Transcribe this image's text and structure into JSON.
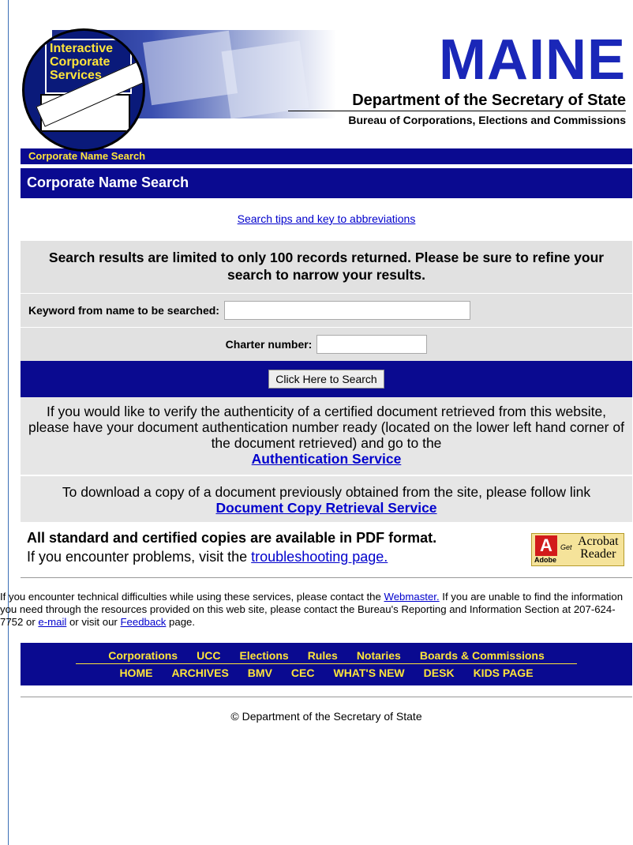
{
  "header": {
    "logo_lines": [
      "Interactive",
      "Corporate",
      "Services"
    ],
    "state": "MAINE",
    "department": "Department of the Secretary of State",
    "bureau": "Bureau of Corporations, Elections and Commissions"
  },
  "breadcrumb": "Corporate Name Search",
  "page_title": "Corporate Name Search",
  "tips_link": "Search tips and key to abbreviations",
  "notice": "Search results are limited to only 100 records returned. Please be sure to refine your search to narrow your results.",
  "form": {
    "keyword_label": "Keyword from name to be searched:",
    "keyword_value": "",
    "charter_label": "Charter number:",
    "charter_value": "",
    "search_button": "Click Here to Search"
  },
  "verify": {
    "text": "If you would like to verify the authenticity of a certified document retrieved from this website, please have your document authentication number ready (located on the lower left hand corner of the document retrieved) and go to the",
    "link": "Authentication Service"
  },
  "download": {
    "text": "To download a copy of a document previously obtained from the site, please follow link",
    "link": "Document Copy Retrieval Service"
  },
  "pdf": {
    "line1": "All standard and certified copies are available in PDF format.",
    "line2_prefix": "If you encounter problems, visit the ",
    "line2_link": "troubleshooting page.",
    "acrobat": {
      "a": "A",
      "brand": "Adobe",
      "get": "Get",
      "reader1": "Acrobat",
      "reader2": "Reader"
    }
  },
  "contact": {
    "t1": "If you encounter technical difficulties while using these services, please contact the ",
    "webmaster": "Webmaster.",
    "t2": " If you are unable to find the information you need through the resources provided on this web site, please contact the Bureau's Reporting and Information Section at 207-624-7752 or ",
    "email": "e-mail",
    "t3": " or visit our ",
    "feedback": "Feedback",
    "t4": " page."
  },
  "nav": {
    "row1": [
      "Corporations",
      "UCC",
      "Elections",
      "Rules",
      "Notaries",
      "Boards & Commissions"
    ],
    "row2": [
      "HOME",
      "ARCHIVES",
      "BMV",
      "CEC",
      "WHAT'S NEW",
      "DESK",
      "KIDS PAGE"
    ]
  },
  "copyright": "© Department of the Secretary of State"
}
